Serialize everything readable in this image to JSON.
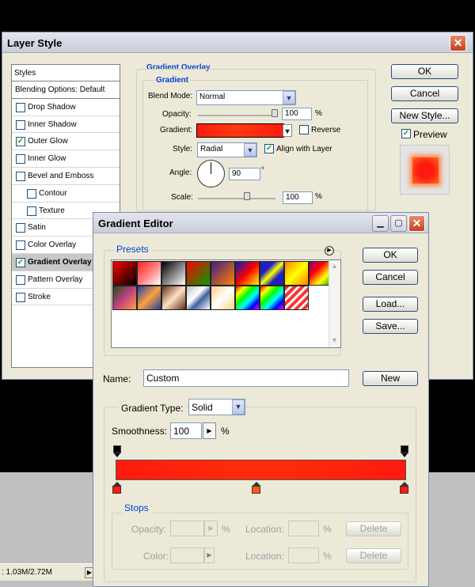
{
  "layer_style": {
    "title": "Layer Style",
    "styles_header": "Styles",
    "blending_options": "Blending Options: Default",
    "styles": [
      {
        "label": "Drop Shadow",
        "checked": false
      },
      {
        "label": "Inner Shadow",
        "checked": false
      },
      {
        "label": "Outer Glow",
        "checked": true
      },
      {
        "label": "Inner Glow",
        "checked": false
      },
      {
        "label": "Bevel and Emboss",
        "checked": false
      },
      {
        "label": "Contour",
        "checked": false
      },
      {
        "label": "Texture",
        "checked": false
      },
      {
        "label": "Satin",
        "checked": false
      },
      {
        "label": "Color Overlay",
        "checked": false
      },
      {
        "label": "Gradient Overlay",
        "checked": true
      },
      {
        "label": "Pattern Overlay",
        "checked": false
      },
      {
        "label": "Stroke",
        "checked": false
      }
    ],
    "section_title": "Gradient Overlay",
    "group_title": "Gradient",
    "blend_mode_label": "Blend Mode:",
    "blend_mode_value": "Normal",
    "opacity_label": "Opacity:",
    "opacity_value": "100",
    "percent": "%",
    "gradient_label": "Gradient:",
    "reverse_label": "Reverse",
    "style_label": "Style:",
    "style_value": "Radial",
    "align_label": "Align with Layer",
    "angle_label": "Angle:",
    "angle_value": "90",
    "degree": "°",
    "scale_label": "Scale:",
    "scale_value": "100",
    "ok": "OK",
    "cancel": "Cancel",
    "new_style": "New Style...",
    "preview": "Preview"
  },
  "gradient_editor": {
    "title": "Gradient Editor",
    "presets_label": "Presets",
    "ok": "OK",
    "cancel": "Cancel",
    "load": "Load...",
    "save": "Save...",
    "name_label": "Name:",
    "name_value": "Custom",
    "new_button": "New",
    "gradient_type_label": "Gradient Type:",
    "gradient_type_value": "Solid",
    "smoothness_label": "Smoothness:",
    "smoothness_value": "100",
    "percent": "%",
    "stops_label": "Stops",
    "opacity_label": "Opacity:",
    "color_label": "Color:",
    "location_label": "Location:",
    "delete_label": "Delete"
  },
  "status": {
    "doc_size": ": 1.03M/2.72M"
  },
  "colors": {
    "gradient_start": "#ff1a0f",
    "gradient_end": "#ff9000"
  }
}
